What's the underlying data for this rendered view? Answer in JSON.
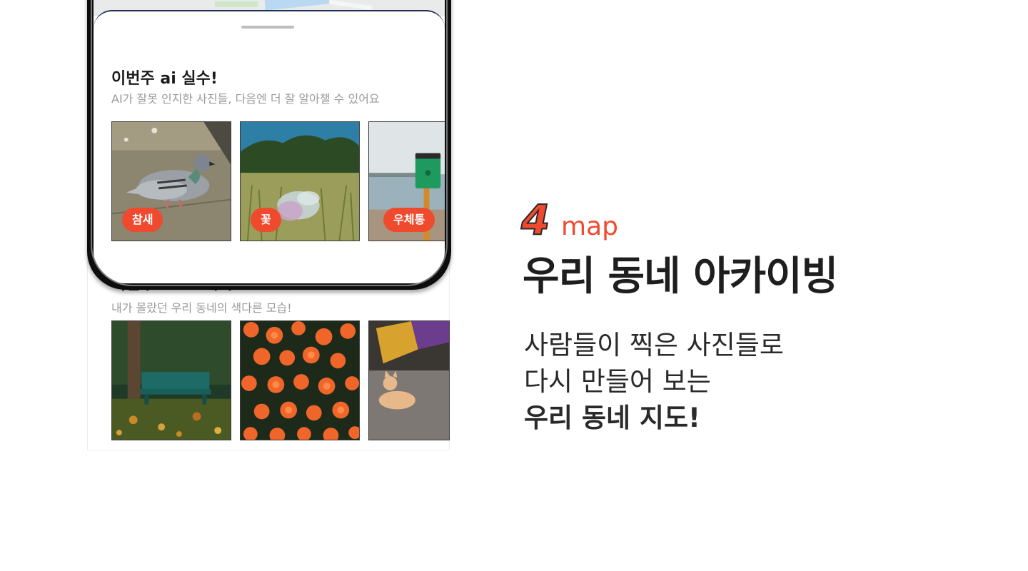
{
  "phone": {
    "sheet": {
      "section1": {
        "title": "이번주 ai 실수!",
        "subtitle": "AI가 잘못 인지한 사진들, 다음엔 더 잘 알아챌 수 있어요",
        "photos": [
          {
            "tag": "참새",
            "image": "pigeon-photo"
          },
          {
            "tag": "꽃",
            "image": "plastic-bag-grass-photo"
          },
          {
            "tag": "우체통",
            "image": "green-trash-bin-photo"
          }
        ]
      },
      "section2": {
        "title": "이번주 포토그래피",
        "subtitle": "내가 몰랐던 우리 동네의 색다른 모습!",
        "photos": [
          {
            "image": "park-bench-photo"
          },
          {
            "image": "orange-flowers-photo"
          },
          {
            "image": "cat-photo"
          }
        ]
      }
    }
  },
  "feature": {
    "number": "4",
    "tag": "map",
    "title": "우리 동네 아카이빙",
    "description": [
      "사람들이 찍은 사진들로",
      "다시 만들어 보는",
      "우리 동네 지도!"
    ]
  },
  "colors": {
    "accent": "#f04a2e",
    "text_dark": "#1e1e1e",
    "text_muted": "#9a9a9a"
  }
}
